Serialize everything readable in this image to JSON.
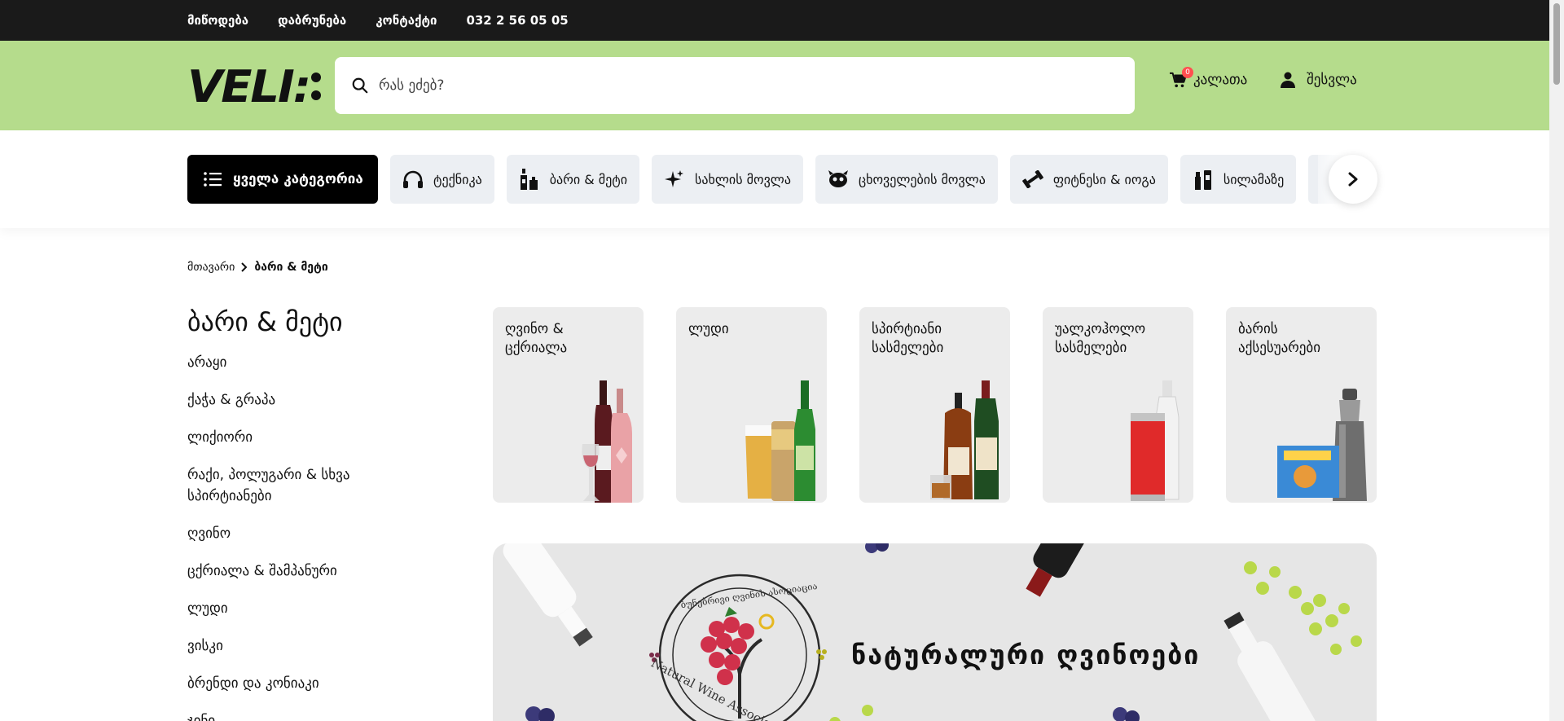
{
  "topbar": {
    "links": [
      "მიწოდება",
      "დაბრუნება",
      "კონტაქტი"
    ],
    "phone": "032 2 56 05 05"
  },
  "header": {
    "logo": "VELI:",
    "search_placeholder": "რას ეძებ?",
    "cart_label": "კალათა",
    "cart_count": "0",
    "login_label": "შესვლა"
  },
  "categories": {
    "all_label": "ყველა კატეგორია",
    "items": [
      {
        "label": "ტექნიკა",
        "icon": "headphones-icon"
      },
      {
        "label": "ბარი & მეტი",
        "icon": "bottles-icon"
      },
      {
        "label": "სახლის მოვლა",
        "icon": "sparkle-icon"
      },
      {
        "label": "ცხოველების მოვლა",
        "icon": "pet-icon"
      },
      {
        "label": "ფიტნესი & იოგა",
        "icon": "dumbbell-icon"
      },
      {
        "label": "სილამაზე",
        "icon": "cosmetics-icon"
      }
    ]
  },
  "breadcrumb": {
    "home": "მთავარი",
    "current": "ბარი & მეტი"
  },
  "sidebar": {
    "title": "ბარი & მეტი",
    "items": [
      "არაყი",
      "ქაჭა & გრაპა",
      "ლიქიორი",
      "რაქი, პოლუგარი & სხვა სპირტიანები",
      "ღვინო",
      "ცქრიალა & შამპანური",
      "ლუდი",
      "ვისკი",
      "ბრენდი და კონიაკი",
      "ჯინი"
    ]
  },
  "subcategories": [
    {
      "label": "ღვინო & ცქრიალა"
    },
    {
      "label": "ლუდი"
    },
    {
      "label": "სპირტიანი სასმელები"
    },
    {
      "label": "უალკოჰოლო სასმელები"
    },
    {
      "label": "ბარის აქსესუარები"
    }
  ],
  "banner": {
    "title": "ნატურალური ღვინოები",
    "seal_text": "Natural Wine Association",
    "seal_text_ka": "ბუნებრივი ღვინის ასოციაცია"
  },
  "colors": {
    "topbar": "#1a1a1a",
    "header": "#b5dc8c",
    "accent_badge": "#ff4f4f"
  }
}
